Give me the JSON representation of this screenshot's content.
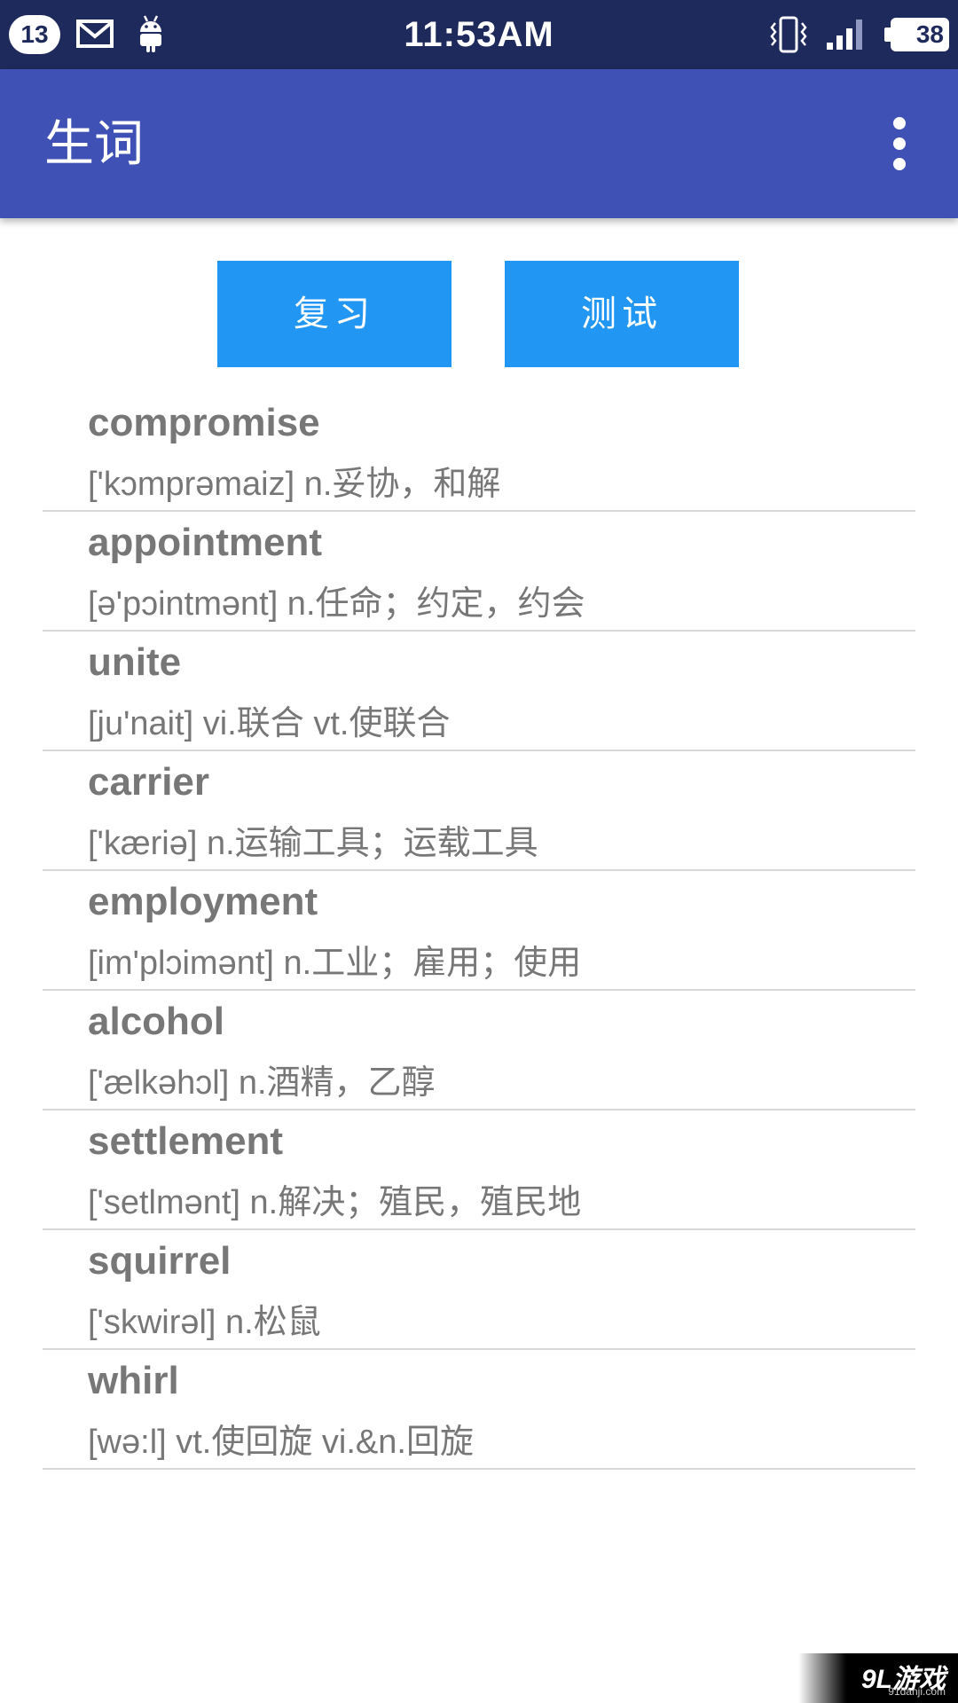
{
  "status_bar": {
    "notification_count": "13",
    "time": "11:53AM",
    "battery": "38",
    "icons": [
      "mail-icon",
      "android-icon",
      "vibrate-icon",
      "signal-icon",
      "battery-icon"
    ]
  },
  "app_bar": {
    "title": "生词",
    "menu_icon": "overflow-menu-icon"
  },
  "actions": {
    "review_label": "复习",
    "test_label": "测试"
  },
  "words": [
    {
      "word": "compromise",
      "meaning": "['kɔmprəmaiz] n.妥协，和解"
    },
    {
      "word": "appointment",
      "meaning": "[ə'pɔintmənt] n.任命；约定，约会"
    },
    {
      "word": "unite",
      "meaning": "[ju'nait] vi.联合 vt.使联合"
    },
    {
      "word": "carrier",
      "meaning": "['kæriə] n.运输工具；运载工具"
    },
    {
      "word": "employment",
      "meaning": "[im'plɔimənt] n.工业；雇用；使用"
    },
    {
      "word": "alcohol",
      "meaning": "['ælkəhɔl] n.酒精，乙醇"
    },
    {
      "word": "settlement",
      "meaning": "['setlmənt] n.解决；殖民，殖民地"
    },
    {
      "word": "squirrel",
      "meaning": "['skwirəl] n.松鼠"
    },
    {
      "word": "whirl",
      "meaning": "[wə:l] vt.使回旋 vi.&n.回旋"
    }
  ],
  "watermark": {
    "logo": "9L游戏",
    "url": "91danji.com"
  },
  "colors": {
    "status_bar": "#1f2a5c",
    "app_bar": "#3f51b5",
    "button": "#2196f3",
    "text": "#777777",
    "divider": "#d8d8d8"
  }
}
